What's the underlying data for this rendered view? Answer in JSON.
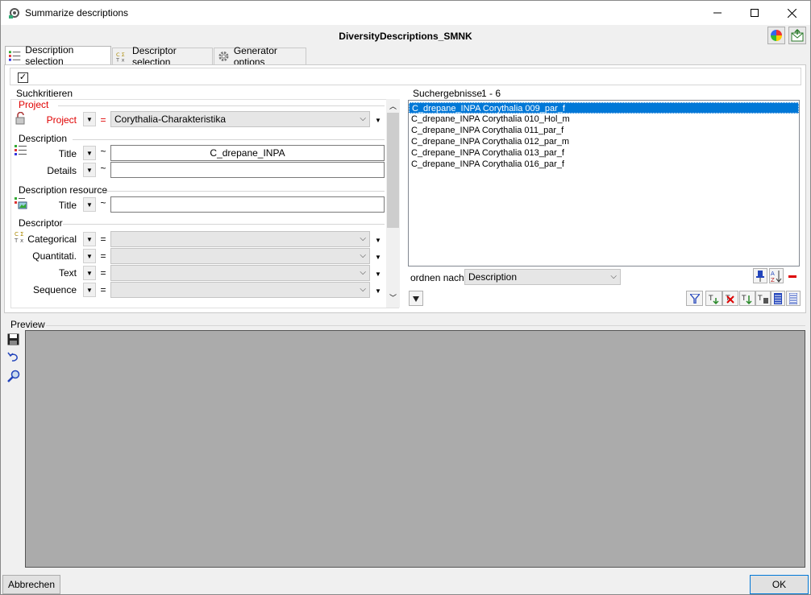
{
  "window": {
    "title": "Summarize descriptions",
    "header_title": "DiversityDescriptions_SMNK"
  },
  "tabs": [
    {
      "label": "Description selection",
      "icon": "description-list-icon"
    },
    {
      "label": "Descriptor selection",
      "icon": "descriptor-icon"
    },
    {
      "label": "Generator options",
      "icon": "gear-icon"
    }
  ],
  "search": {
    "header": "Suchkritieren",
    "project_group": "Project",
    "project_label": "Project",
    "project_operator": "=",
    "project_value": "Corythalia-Charakteristika",
    "description_group": "Description",
    "title_label": "Title",
    "title_operator": "~",
    "title_value": "C_drepane_INPA",
    "details_label": "Details",
    "details_operator": "~",
    "details_value": "",
    "resource_group": "Description resource",
    "resource_title_label": "Title",
    "resource_title_operator": "~",
    "resource_title_value": "",
    "descriptor_group": "Descriptor",
    "categorical_label": "Categorical",
    "quantitative_label": "Quantitati.",
    "text_label": "Text",
    "sequence_label": "Sequence",
    "descriptor_operator": "="
  },
  "results": {
    "header": "Suchergebnisse",
    "range": "1 - 6",
    "items": [
      "C_drepane_INPA Corythalia 009_par_f",
      "C_drepane_INPA Corythalia 010_Hol_m",
      "C_drepane_INPA Corythalia 011_par_f",
      "C_drepane_INPA Corythalia 012_par_m",
      "C_drepane_INPA Corythalia 013_par_f",
      "C_drepane_INPA Corythalia 016_par_f"
    ],
    "sort_label": "ordnen nach:",
    "sort_value": "Description"
  },
  "preview": {
    "label": "Preview"
  },
  "buttons": {
    "cancel": "Abbrechen",
    "ok": "OK"
  },
  "colors": {
    "accent": "#0078d7",
    "project_red": "#e00000",
    "preview_bg": "#ababab"
  }
}
